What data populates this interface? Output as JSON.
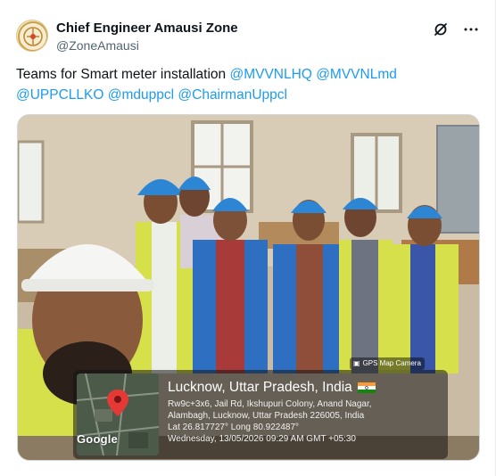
{
  "tweet": {
    "author": {
      "display_name": "Chief Engineer Amausi Zone",
      "handle": "@ZoneAmausi",
      "avatar_icon": "emblem-logo-icon"
    },
    "actions": {
      "grok_icon": "grok-icon",
      "more_icon": "more-options-icon"
    },
    "text_prefix": "Teams for Smart meter installation ",
    "mentions": [
      "@MVVNLHQ",
      "@MVVNLmd",
      "@UPPCLLKO",
      "@mduppcl",
      "@ChairmanUppcl"
    ]
  },
  "photo": {
    "badge": "GPS Map Camera",
    "location_title": "Lucknow, Uttar Pradesh, India",
    "address_line1": "Rw9c+3x6, Jail Rd, Ikshupuri Colony, Anand Nagar,",
    "address_line2": "Alambagh, Lucknow, Uttar Pradesh 226005, India",
    "coords": "Lat 26.817727° Long 80.922487°",
    "timestamp": "Wednesday, 13/05/2026 09:29 AM GMT +05:30",
    "map_logo": "Google"
  },
  "colors": {
    "link": "#1d9bf0",
    "text": "#0f1419",
    "secondary": "#536471",
    "helmet_blue": "#2d86d4",
    "vest_yellow": "#d6e04a",
    "vest_blue": "#2f6fc2"
  }
}
